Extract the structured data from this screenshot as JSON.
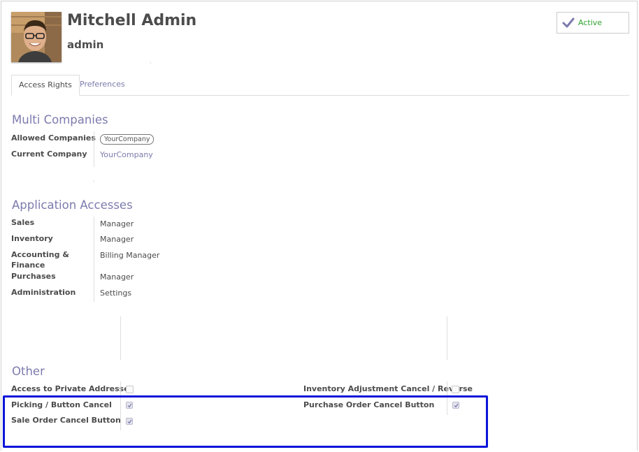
{
  "user": {
    "name": "Mitchell Admin",
    "login": "admin"
  },
  "status_button": {
    "label": "Active",
    "color": "#2ea32e",
    "icon": "check-icon"
  },
  "tabs": [
    {
      "label": "Access Rights",
      "active": true
    },
    {
      "label": "Preferences",
      "active": false
    }
  ],
  "multi_companies": {
    "title": "Multi Companies",
    "allowed_label": "Allowed Companies",
    "allowed_value": "YourCompany",
    "current_label": "Current Company",
    "current_value": "YourCompany"
  },
  "application_accesses": {
    "title": "Application Accesses",
    "rows": [
      {
        "label": "Sales",
        "value": "Manager"
      },
      {
        "label": "Inventory",
        "value": "Manager"
      },
      {
        "label": "Accounting & Finance",
        "value": "Billing Manager"
      },
      {
        "label": "Purchases",
        "value": "Manager"
      },
      {
        "label": "Administration",
        "value": "Settings"
      }
    ]
  },
  "other": {
    "title": "Other",
    "left": [
      {
        "label": "Access to Private Addresses",
        "checked": false
      },
      {
        "label": "Picking / Button Cancel",
        "checked": true
      },
      {
        "label": "Sale Order Cancel Button",
        "checked": true
      }
    ],
    "right": [
      {
        "label": "Inventory Adjustment Cancel / Reverse",
        "checked": false
      },
      {
        "label": "Purchase Order Cancel Button",
        "checked": true
      }
    ]
  },
  "colors": {
    "accent": "#7c7bad",
    "highlight": "#0a14d8",
    "text": "#4c4c4c"
  }
}
